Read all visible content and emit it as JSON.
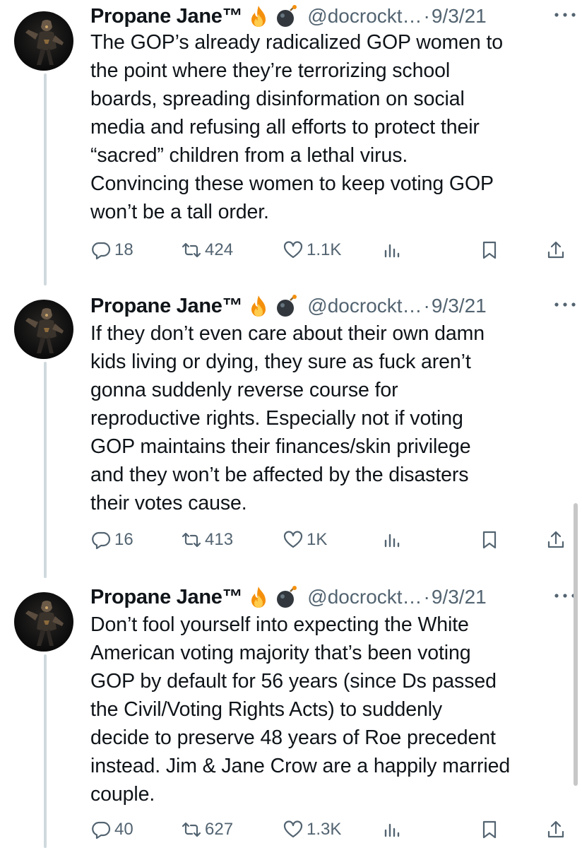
{
  "tweets": [
    {
      "author": "Propane Jane™",
      "handle": "@docrockt…",
      "separator": "·",
      "date": "9/3/21",
      "text": "The GOP’s already radicalized GOP women to\nthe point where they’re terrorizing school\nboards, spreading disinformation on social\nmedia and refusing all efforts to protect their\n“sacred” children from a lethal virus.\nConvincing these women to keep voting GOP\nwon’t be a tall order.",
      "replies": "18",
      "retweets": "424",
      "likes": "1.1K"
    },
    {
      "author": "Propane Jane™",
      "handle": "@docrockt…",
      "separator": "·",
      "date": "9/3/21",
      "text": "If they don’t even care about their own damn\nkids living or dying, they sure as fuck aren’t\ngonna suddenly reverse course for\nreproductive rights. Especially not if voting\nGOP maintains their finances/skin privilege\nand they won’t be affected by the disasters\ntheir votes cause.",
      "replies": "16",
      "retweets": "413",
      "likes": "1K"
    },
    {
      "author": "Propane Jane™",
      "handle": "@docrockt…",
      "separator": "·",
      "date": "9/3/21",
      "text": "Don’t fool yourself into expecting the White\nAmerican voting majority that’s been voting\nGOP by default for 56 years (since Ds passed\nthe Civil/Voting Rights Acts) to suddenly\ndecide to preserve 48 years of Roe precedent\ninstead. Jim & Jane Crow are a happily married\ncouple.",
      "replies": "40",
      "retweets": "627",
      "likes": "1.3K"
    }
  ],
  "icons": {
    "reply": "reply-icon",
    "retweet": "retweet-icon",
    "like": "heart-icon",
    "views": "views-icon",
    "bookmark": "bookmark-icon",
    "share": "share-icon",
    "more": "more-icon"
  },
  "colors": {
    "text": "#0f1419",
    "secondary": "#536471",
    "thread_line": "#cfd9de"
  }
}
